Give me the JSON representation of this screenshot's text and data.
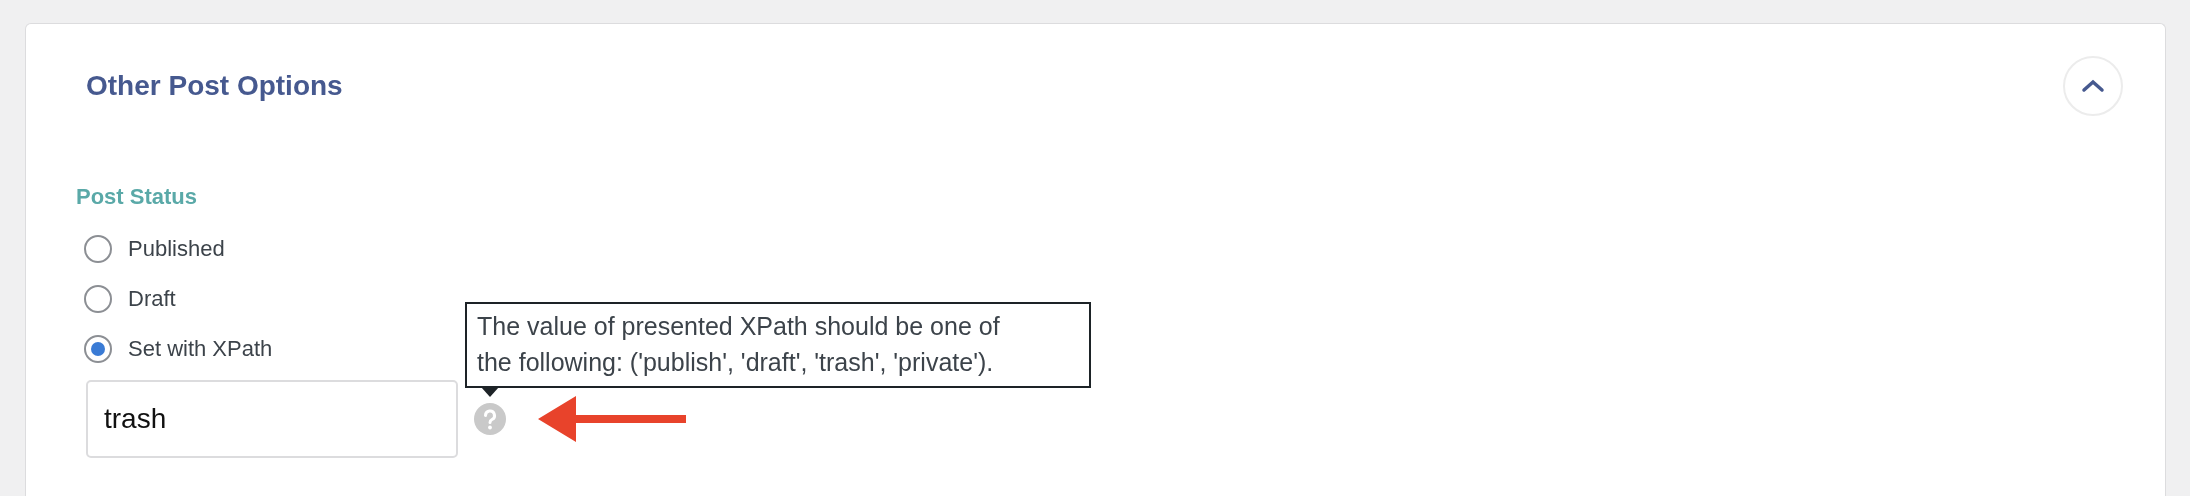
{
  "panel": {
    "title": "Other Post Options",
    "expanded": true
  },
  "post_status": {
    "label": "Post Status",
    "options": [
      {
        "label": "Published",
        "selected": false
      },
      {
        "label": "Draft",
        "selected": false
      },
      {
        "label": "Set with XPath",
        "selected": true
      }
    ],
    "xpath_value": "trash",
    "tooltip": "The value of presented XPath should be one of the following: ('publish', 'draft', 'trash', 'private')."
  }
}
